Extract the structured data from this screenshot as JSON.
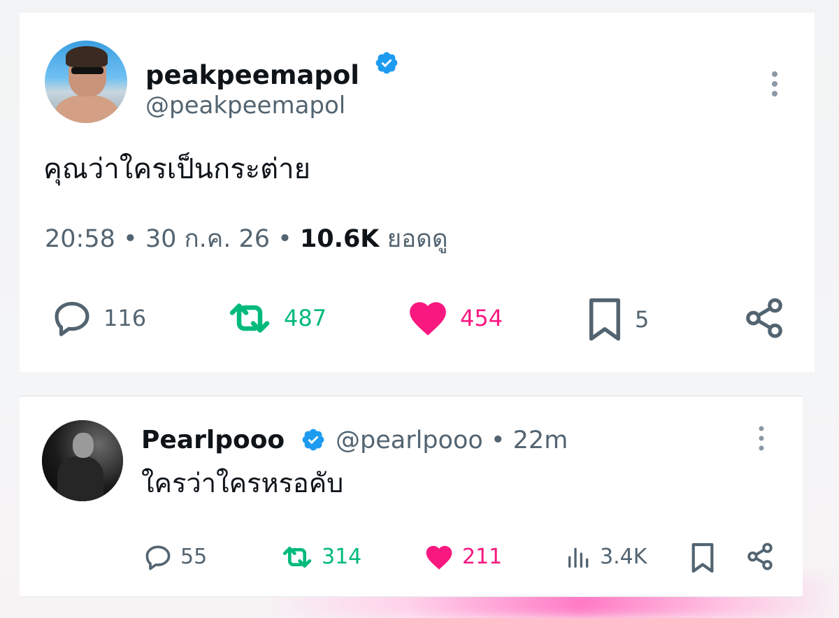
{
  "colors": {
    "text": "#0f1419",
    "muted": "#536471",
    "verified": "#1d9bf0",
    "retweet": "#00ba7c",
    "like": "#f91880"
  },
  "tweet": {
    "display_name": "peakpeemapol",
    "handle": "@peakpeemapol",
    "verified_icon": "verified-badge-icon",
    "text": "คุณว่าใครเป็นกระต่าย",
    "time": "20:58",
    "date": "30 ก.ค. 26",
    "views_count": "10.6K",
    "views_label": "ยอดดู",
    "separator": "•",
    "actions": {
      "reply_count": "116",
      "retweet_count": "487",
      "like_count": "454",
      "bookmark_count": "5"
    }
  },
  "reply": {
    "display_name": "Pearlpooo",
    "handle_time": "@pearlpooo • 22m",
    "text": "ใครว่าใครหรอคับ",
    "actions": {
      "reply_count": "55",
      "retweet_count": "314",
      "like_count": "211",
      "views_count": "3.4K"
    }
  }
}
